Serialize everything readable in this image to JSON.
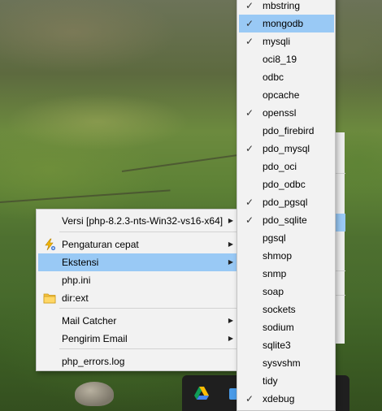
{
  "context_menu": {
    "items": [
      {
        "label": "Versi [php-8.2.3-nts-Win32-vs16-x64]",
        "has_submenu": true,
        "icon": ""
      },
      {
        "label": "Pengaturan cepat",
        "has_submenu": true,
        "icon": "lightning-gear-icon"
      },
      {
        "label": "Ekstensi",
        "has_submenu": true,
        "icon": "",
        "active": true
      },
      {
        "label": "php.ini",
        "has_submenu": false,
        "icon": ""
      },
      {
        "label": "dir:ext",
        "has_submenu": false,
        "icon": "folder-icon"
      },
      {
        "label": "Mail Catcher",
        "has_submenu": true,
        "icon": ""
      },
      {
        "label": "Pengirim Email",
        "has_submenu": true,
        "icon": ""
      },
      {
        "label": "php_errors.log",
        "has_submenu": false,
        "icon": ""
      }
    ]
  },
  "submenu": {
    "items": [
      {
        "label": "mbstring",
        "checked": true
      },
      {
        "label": "mongodb",
        "checked": true,
        "active": true
      },
      {
        "label": "mysqli",
        "checked": true
      },
      {
        "label": "oci8_19",
        "checked": false
      },
      {
        "label": "odbc",
        "checked": false
      },
      {
        "label": "opcache",
        "checked": false
      },
      {
        "label": "openssl",
        "checked": true
      },
      {
        "label": "pdo_firebird",
        "checked": false
      },
      {
        "label": "pdo_mysql",
        "checked": true
      },
      {
        "label": "pdo_oci",
        "checked": false
      },
      {
        "label": "pdo_odbc",
        "checked": false
      },
      {
        "label": "pdo_pgsql",
        "checked": true
      },
      {
        "label": "pdo_sqlite",
        "checked": true
      },
      {
        "label": "pgsql",
        "checked": false
      },
      {
        "label": "shmop",
        "checked": false
      },
      {
        "label": "snmp",
        "checked": false
      },
      {
        "label": "soap",
        "checked": false
      },
      {
        "label": "sockets",
        "checked": false
      },
      {
        "label": "sodium",
        "checked": false
      },
      {
        "label": "sqlite3",
        "checked": false
      },
      {
        "label": "sysvshm",
        "checked": false
      },
      {
        "label": "tidy",
        "checked": false
      },
      {
        "label": "xdebug",
        "checked": true
      }
    ]
  },
  "colors": {
    "highlight": "#99c9f5",
    "menu_bg": "#f2f2f2"
  }
}
